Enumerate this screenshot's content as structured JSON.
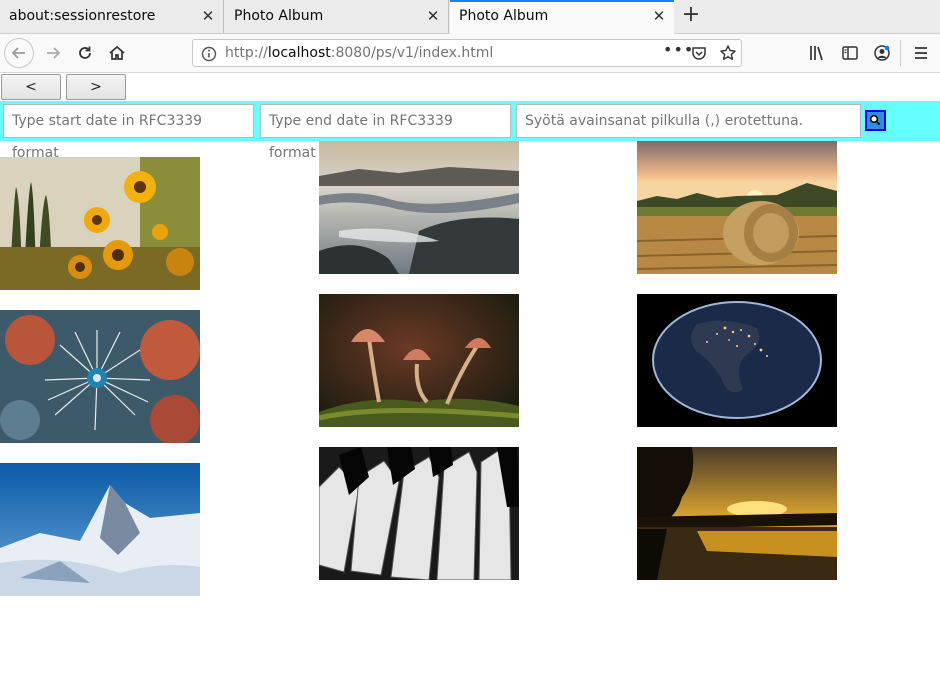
{
  "tabs": [
    {
      "title": "about:sessionrestore",
      "active": false
    },
    {
      "title": "Photo Album",
      "active": false
    },
    {
      "title": "Photo Album",
      "active": true
    }
  ],
  "new_tab_symbol": "+",
  "url": {
    "prefix": "http://",
    "host": "localhost",
    "rest": ":8080/ps/v1/index.html"
  },
  "url_more": "•••",
  "nav": {
    "prev_label": "<",
    "next_label": ">"
  },
  "search": {
    "start_placeholder": "Type start date in RFC3339 format",
    "end_placeholder": "Type end date in RFC3339 format",
    "keywords_placeholder": "Syötä avainsanat pilkulla (,) erotettuna."
  },
  "colors": {
    "search_bar": "#66ffff",
    "accent": "#0a84ff"
  },
  "photos": [
    {
      "subject": "sunflowers"
    },
    {
      "subject": "misty hills"
    },
    {
      "subject": "hay bale at sunset"
    },
    {
      "subject": "dandelion seed head"
    },
    {
      "subject": "mushrooms"
    },
    {
      "subject": "earth at night"
    },
    {
      "subject": "snowy mountain peak"
    },
    {
      "subject": "piano keys"
    },
    {
      "subject": "sunset over lake"
    }
  ]
}
